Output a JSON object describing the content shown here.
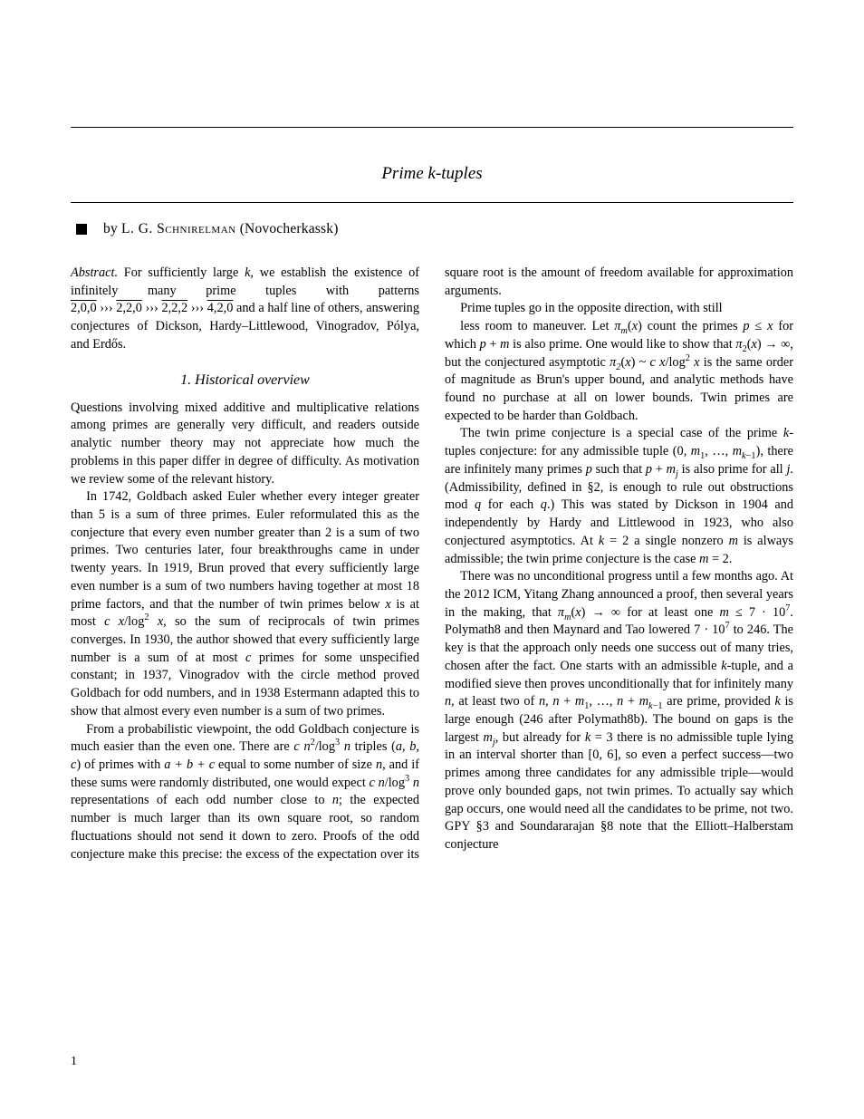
{
  "title": {
    "prefix": "Prime",
    "math": "k",
    "suffix": "-tuples"
  },
  "author_line": {
    "prefix": "by",
    "name": "L. G. Schnirelman",
    "affiliation": "(Novocherkassk)"
  },
  "abstract": {
    "label": "Abstract.",
    "text_1": "For sufficiently large ",
    "text_2": ", we establish the existence of infinitely many prime tuples with patterns ",
    "pattern_seq": [
      "2,0,0",
      "2,2,0",
      "2,2,2",
      "4,2,0"
    ],
    "half_line_suffix": " and a half line of others, answering conjectures of Dickson, Hardy–Littlewood, Vinogradov, Pólya, and Erdős."
  },
  "sections": {
    "one": {
      "heading": "1. Historical overview",
      "paragraphs": [
        "Questions involving mixed additive and multiplicative relations among primes are generally very difficult, and readers outside analytic number theory may not appreciate how much the problems in this paper differ in degree of difficulty. As motivation we review some of the relevant history.",
        "In 1742, Goldbach asked Euler whether every integer greater than 5 is a sum of three primes. Euler reformulated this as the conjecture that every even number greater than 2 is a sum of two primes. Two centuries later, four breakthroughs came in under twenty years. In 1919, Brun proved that every sufficiently large even number is a sum of two numbers having together at most 18 prime factors, and that the number of twin primes below <span class=\"math\">x</span> is at most <span class=\"math\">c x</span>/log<sup>2</sup> <span class=\"math\">x</span>, so the sum of reciprocals of twin primes converges. In 1930, the author showed that every sufficiently large number is a sum of at most <span class=\"math\">c</span> primes for some unspecified constant; in 1937, Vinogradov with the circle method proved Goldbach for odd numbers, and in 1938 Estermann adapted this to show that almost every even number is a sum of two primes.",
        "From a probabilistic viewpoint, the odd Goldbach conjecture is much easier than the even one. There are <span class=\"math\">c n</span><sup>2</sup>/log<sup>3</sup> <span class=\"math\">n</span> triples (<span class=\"math\">a, b, c</span>) of primes with <span class=\"math\">a + b + c</span> equal to some number of size <span class=\"math\">n</span>, and if these sums were randomly distributed, one would expect <span class=\"math\">c n</span>/log<sup>3</sup> <span class=\"math\">n</span> representations of each odd number close to <span class=\"math\">n</span>; the expected number is much larger than its own square root, so random fluctuations should not send it down to zero. Proofs of the odd conjecture make this precise: the excess of the expectation over its square root is the amount of freedom available for approximation arguments.",
        "Prime tuples go in the opposite direction, with still",
        "less room to maneuver. Let <span class=\"math\">π<sub>m</sub></span>(<span class=\"math\">x</span>) count the primes <span class=\"math\">p</span> &le; <span class=\"math\">x</span> for which <span class=\"math\">p</span> + <span class=\"math\">m</span> is also prime. One would like to show that <span class=\"math\">π</span><sub>2</sub>(<span class=\"math\">x</span>) &rarr; ∞, but the conjectured asymptotic <span class=\"math\">π<sub>2</sub></span>(<span class=\"math\">x</span>) ~ <span class=\"math\">c x</span>/log<sup>2</sup> <span class=\"math\">x</span> is the same order of magnitude as Brun's upper bound, and analytic methods have found no purchase at all on lower bounds. Twin primes are expected to be harder than Goldbach.",
        "The twin prime conjecture is a special case of the prime <span class=\"math\">k</span>-tuples conjecture: for any admissible tuple (0, <span class=\"math\">m</span><sub>1</sub>, …, <span class=\"math\">m</span><sub><span class=\"math\">k</span>&minus;1</sub>), there are infinitely many primes <span class=\"math\">p</span> such that <span class=\"math\">p</span> + <span class=\"math\">m<sub>j</sub></span> is also prime for all <span class=\"math\">j</span>. (Admissibility, defined in §2, is enough to rule out obstructions mod <span class=\"math\">q</span> for each <span class=\"math\">q</span>.) This was stated by Dickson in 1904 and independently by Hardy and Littlewood in 1923, who also conjectured asymptotics. At <span class=\"math\">k</span> = 2 a single nonzero <span class=\"math\">m</span> is always admissible; the twin prime conjecture is the case <span class=\"math\">m</span> = 2.",
        "There was no unconditional progress until a few months ago. At the 2012 ICM, Yitang Zhang announced a proof, then several years in the making, that <span class=\"math\">π<sub>m</sub></span>(<span class=\"math\">x</span>) &rarr; ∞ for at least one <span class=\"math\">m</span> &le; 7 &middot; 10<sup>7</sup>. Polymath8 and then Maynard and Tao lowered 7 &middot; 10<sup>7</sup> to 246. The key is that the approach only needs one success out of many tries, chosen after the fact. One starts with an admissible <span class=\"math\">k</span>-tuple, and a modified sieve then proves unconditionally that for infinitely many <span class=\"math\">n</span>, at least two of <span class=\"math\">n</span>, <span class=\"math\">n</span> + <span class=\"math\">m</span><sub>1</sub>, …, <span class=\"math\">n</span> + <span class=\"math\">m</span><sub><span class=\"math\">k</span>&minus;1</sub> are prime, provided <span class=\"math\">k</span> is large enough (246 after Polymath8b). The bound on gaps is the largest <span class=\"math\">m<sub>j</sub></span>, but already for <span class=\"math\">k</span> = 3 there is no admissible tuple lying in an interval shorter than [0, 6], so even a perfect success—two primes among three candidates for any admissible triple—would prove only bounded gaps, not twin primes. To actually say which gap occurs, one would need all the candidates to be prime, not two. GPY &sect;3 and Soundararajan §8 note that the Elliott–Halberstam conjecture"
      ]
    }
  },
  "footer": {
    "page_number": "1"
  }
}
